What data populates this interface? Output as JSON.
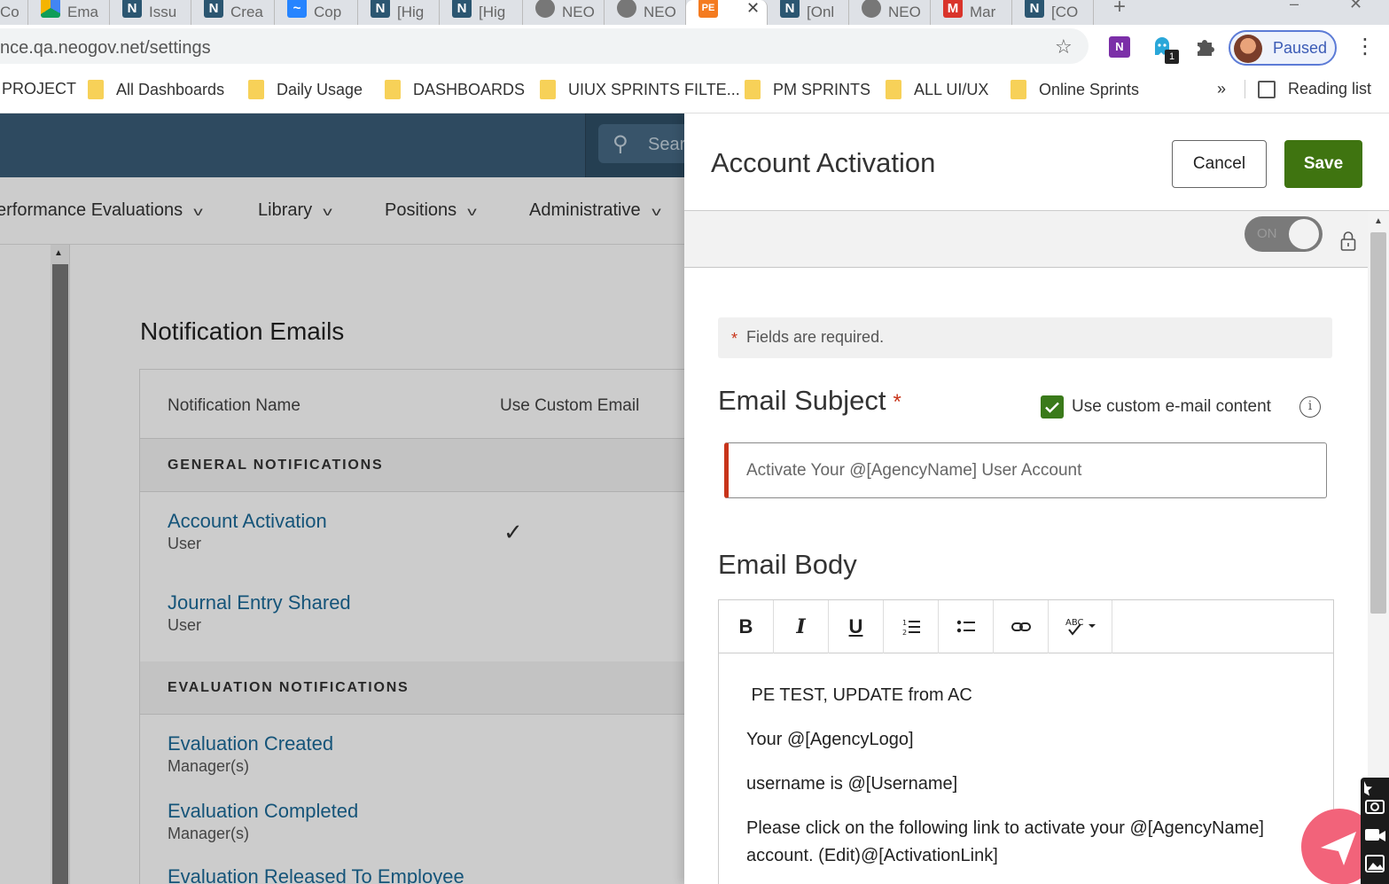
{
  "browser": {
    "tabs": [
      {
        "label": "Co",
        "icon": "neogov-icon"
      },
      {
        "label": "Ema",
        "icon": "google-drive-icon"
      },
      {
        "label": "Issu",
        "icon": "notion-icon"
      },
      {
        "label": "Crea",
        "icon": "notion-icon"
      },
      {
        "label": "Cop",
        "icon": "confluence-icon"
      },
      {
        "label": "[Hig",
        "icon": "notion-icon"
      },
      {
        "label": "[Hig",
        "icon": "notion-icon"
      },
      {
        "label": "NEO",
        "icon": "globe-icon"
      },
      {
        "label": "NEO",
        "icon": "globe-icon"
      },
      {
        "label": "",
        "icon": "pe-icon"
      },
      {
        "label": "[Onl",
        "icon": "notion-icon"
      },
      {
        "label": "NEO",
        "icon": "globe-icon"
      },
      {
        "label": "Mar",
        "icon": "marvel-icon"
      },
      {
        "label": "[CO",
        "icon": "notion-icon"
      }
    ],
    "url": "nce.qa.neogov.net/settings",
    "profile_status": "Paused",
    "extension_badge": "1",
    "bookmarks": [
      "PROJECT",
      "All Dashboards",
      "Daily Usage",
      "DASHBOARDS",
      "UIUX SPRINTS FILTE...",
      "PM SPRINTS",
      "ALL UI/UX",
      "Online Sprints"
    ],
    "bookmarks_overflow": "»",
    "reading_list": "Reading list"
  },
  "app": {
    "search_placeholder": "Sear",
    "menu": [
      {
        "label": "erformance Evaluations"
      },
      {
        "label": "Library"
      },
      {
        "label": "Positions"
      },
      {
        "label": "Administrative"
      }
    ],
    "page_title": "Notification Emails",
    "table": {
      "col_name": "Notification Name",
      "col_custom": "Use Custom Email",
      "sections": [
        {
          "title": "GENERAL NOTIFICATIONS",
          "items": [
            {
              "name": "Account Activation",
              "recipient": "User",
              "custom": true
            },
            {
              "name": "Journal Entry Shared",
              "recipient": "User",
              "custom": false
            }
          ]
        },
        {
          "title": "EVALUATION NOTIFICATIONS",
          "items": [
            {
              "name": "Evaluation Created",
              "recipient": "Manager(s)",
              "custom": false
            },
            {
              "name": "Evaluation Completed",
              "recipient": "Manager(s)",
              "custom": false
            },
            {
              "name": "Evaluation Released To Employee",
              "recipient": "",
              "custom": false
            }
          ]
        }
      ]
    }
  },
  "drawer": {
    "title": "Account Activation",
    "cancel_label": "Cancel",
    "save_label": "Save",
    "toggle_label": "ON",
    "required_asterisk": "*",
    "required_note": "Fields are required.",
    "subject_label": "Email Subject",
    "custom_content_label": "Use custom e-mail content",
    "custom_content_checked": true,
    "info_glyph": "i",
    "subject_value": "Activate Your @[AgencyName] User Account",
    "body_label": "Email Body",
    "toolbar": [
      "bold",
      "italic",
      "underline",
      "ordered-list",
      "bullet-list",
      "link",
      "spellcheck"
    ],
    "body_lines": [
      " PE TEST, UPDATE from AC",
      "Your @[AgencyLogo]",
      "username is @[Username]",
      "Please click on the following link to activate your @[AgencyName] account. (Edit)@[ActivationLink]"
    ]
  },
  "colors": {
    "nav_bg": "#3a5d78",
    "link": "#1b6a98",
    "save": "#3f7410",
    "required": "#c8341a",
    "fab": "#f2637a"
  }
}
